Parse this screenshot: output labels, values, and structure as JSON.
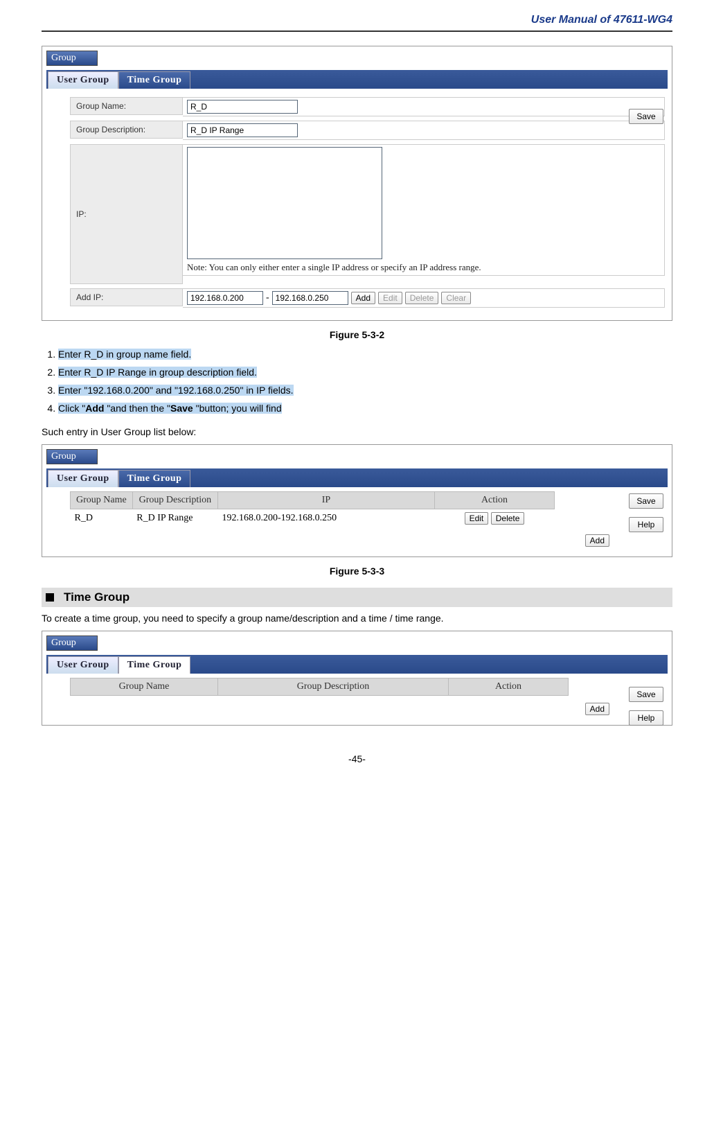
{
  "doc": {
    "header": "User Manual of 47611-WG4",
    "page_number": "-45-"
  },
  "fig1": {
    "panel_title": "Group",
    "tabs": {
      "user": "User Group",
      "time": "Time Group"
    },
    "labels": {
      "group_name": "Group Name:",
      "group_desc": "Group Description:",
      "ip": "IP:",
      "add_ip": "Add IP:"
    },
    "values": {
      "group_name": "R_D",
      "group_desc": "R_D IP Range",
      "ip_list": "",
      "ip_start": "192.168.0.200",
      "ip_end": "192.168.0.250"
    },
    "note": "Note: You can only either enter a single IP address or specify an IP address range.",
    "buttons": {
      "add": "Add",
      "edit": "Edit",
      "delete": "Delete",
      "clear": "Clear",
      "save": "Save"
    },
    "caption": "Figure 5-3-2"
  },
  "steps": {
    "s1": "Enter R_D in group name field.",
    "s2": "Enter R_D IP Range in group description field.",
    "s3": "Enter \"192.168.0.200\" and \"192.168.0.250\" in IP fields.",
    "s4_a": "Click \"",
    "s4_b": "Add ",
    "s4_c": "\"and then the \"",
    "s4_d": "Save ",
    "s4_e": "\"button; you will find"
  },
  "para_between": "Such entry in User Group list below:",
  "fig2": {
    "panel_title": "Group",
    "tabs": {
      "user": "User Group",
      "time": "Time Group"
    },
    "headers": {
      "name": "Group Name",
      "desc": "Group Description",
      "ip": "IP",
      "action": "Action"
    },
    "row": {
      "name": "R_D",
      "desc": "R_D IP Range",
      "ip": "192.168.0.200-192.168.0.250"
    },
    "buttons": {
      "edit": "Edit",
      "delete": "Delete",
      "add": "Add",
      "save": "Save",
      "help": "Help"
    },
    "caption": "Figure 5-3-3"
  },
  "section": {
    "title": "Time Group",
    "para": "To create a time group, you need to specify a group name/description and a time / time range."
  },
  "fig3": {
    "panel_title": "Group",
    "tabs": {
      "user": "User Group",
      "time": "Time Group"
    },
    "headers": {
      "name": "Group Name",
      "desc": "Group Description",
      "action": "Action"
    },
    "buttons": {
      "add": "Add",
      "save": "Save",
      "help": "Help"
    }
  }
}
